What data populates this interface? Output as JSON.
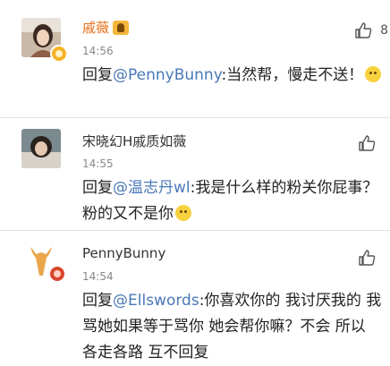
{
  "comments": [
    {
      "username": "戚薇",
      "time": "14:56",
      "reply_prefix": "回复",
      "mention": "@PennyBunny",
      "text": ":当然帮，慢走不送！",
      "likes": "8"
    },
    {
      "username": "宋晓幻H戚质如薇",
      "time": "14:55",
      "reply_prefix": "回复",
      "mention": "@温志丹wl",
      "text": ":我是什么样的粉关你屁事？粉的又不是你"
    },
    {
      "username": "PennyBunny",
      "time": "14:54",
      "reply_prefix": "回复",
      "mention": "@Ellswords",
      "text": ":你喜欢你的 我讨厌我的 我骂她如果等于骂你 她会帮你嘛？不会 所以 各走各路 互不回复"
    }
  ],
  "colors": {
    "name_verified": "#e8701a",
    "mention": "#4a78b8",
    "time": "#888888",
    "separator": "#e2e2e2"
  },
  "icons": [
    "avatar",
    "verified-badge-icon",
    "vip-crown-icon",
    "emoji-icon",
    "thumbs-up-icon"
  ]
}
